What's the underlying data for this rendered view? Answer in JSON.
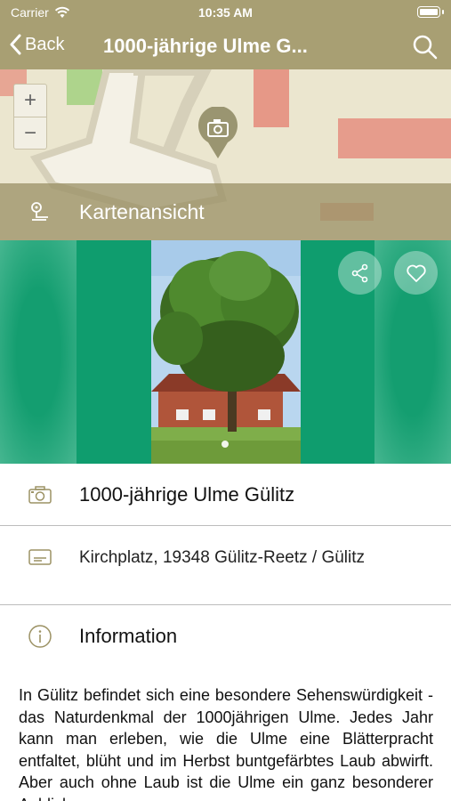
{
  "status_bar": {
    "carrier": "Carrier",
    "time": "10:35 AM"
  },
  "nav": {
    "back_label": "Back",
    "title": "1000-jährige Ulme G..."
  },
  "map": {
    "zoom_in": "+",
    "zoom_out": "−",
    "overlay_label": "Kartenansicht"
  },
  "gallery": {
    "photo_count": 1,
    "active_index": 1
  },
  "details": {
    "name": "1000-jährige Ulme Gülitz",
    "address": "Kirchplatz, 19348 Gülitz-Reetz / Gülitz",
    "info_heading": "Information",
    "description": "In Gülitz befindet sich eine besondere Sehenswürdigkeit - das Naturdenkmal der 1000jährigen Ulme. Jedes Jahr kann man erleben, wie die Ulme eine Blätterpracht entfaltet, blüht und im Herbst buntgefärbtes Laub abwirft. Aber auch ohne Laub ist die Ulme ein ganz besonderer Anblick."
  },
  "colors": {
    "header": "#a89f73",
    "gallery_green": "#0f9d6e",
    "icon_tint": "#9c9264"
  },
  "icons": [
    "wifi-icon",
    "battery-icon",
    "chevron-left-icon",
    "search-icon",
    "camera-icon",
    "map-pin-icon",
    "share-icon",
    "heart-icon",
    "address-card-icon",
    "info-icon"
  ]
}
